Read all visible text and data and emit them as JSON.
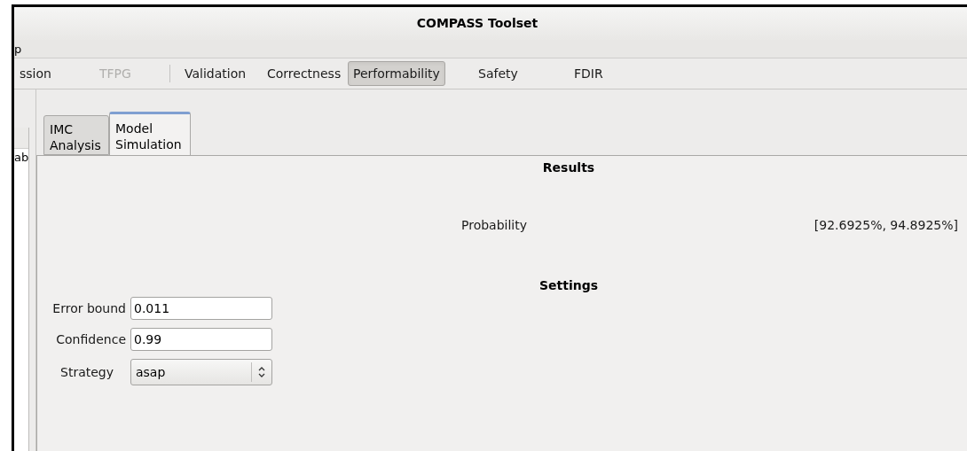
{
  "window": {
    "title": "COMPASS Toolset"
  },
  "menu": [
    "p"
  ],
  "toolbar": [
    {
      "label": "ssion",
      "selected": false,
      "disabled": false,
      "kind": "button"
    },
    {
      "label": "TFPG",
      "selected": false,
      "disabled": true,
      "kind": "button"
    },
    {
      "kind": "separator"
    },
    {
      "label": "Validation",
      "selected": false,
      "disabled": false,
      "kind": "button"
    },
    {
      "label": "Correctness",
      "selected": false,
      "disabled": false,
      "kind": "button"
    },
    {
      "label": "Performability",
      "selected": true,
      "disabled": false,
      "kind": "button"
    },
    {
      "label": "Safety",
      "selected": false,
      "disabled": false,
      "kind": "button"
    },
    {
      "label": "FDIR",
      "selected": false,
      "disabled": false,
      "kind": "button"
    }
  ],
  "side_panel": {
    "item": "ab"
  },
  "tabs": [
    {
      "label": "IMC Analysis",
      "selected": false
    },
    {
      "label": "Model Simulation",
      "selected": true
    }
  ],
  "results": {
    "heading": "Results",
    "rows": [
      {
        "label": "Probability",
        "value": "[92.6925%, 94.8925%]"
      }
    ]
  },
  "settings": {
    "heading": "Settings",
    "fields": [
      {
        "kind": "text",
        "label": "Error bound",
        "value": "0.011"
      },
      {
        "kind": "text",
        "label": "Confidence",
        "value": "0.99"
      },
      {
        "kind": "select",
        "label": "Strategy",
        "value": "asap"
      }
    ]
  }
}
